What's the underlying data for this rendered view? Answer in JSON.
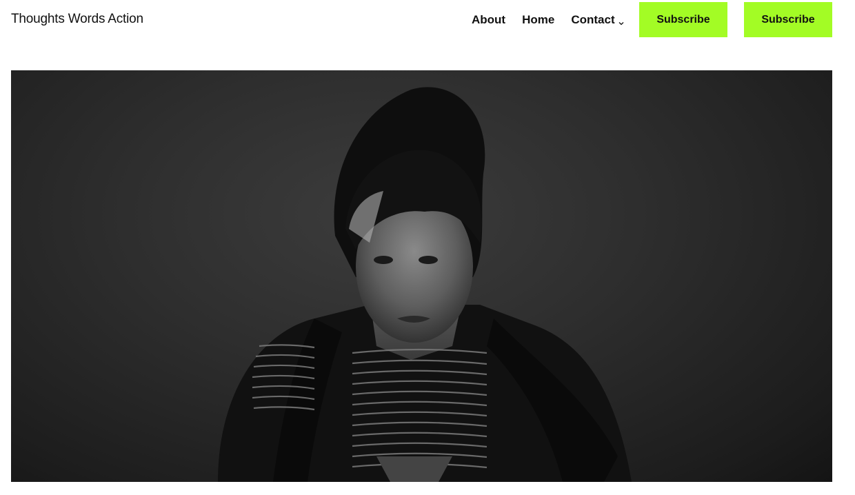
{
  "header": {
    "site_title": "Thoughts Words Action",
    "nav": {
      "about": "About",
      "home": "Home",
      "contact": "Contact"
    },
    "subscribe_primary": "Subscribe",
    "subscribe_secondary": "Subscribe"
  },
  "hero": {
    "image_icon": "portrait-photo"
  },
  "colors": {
    "accent": "#a3fc25",
    "text": "#111111",
    "hero_bg": "#2e2e2e"
  }
}
